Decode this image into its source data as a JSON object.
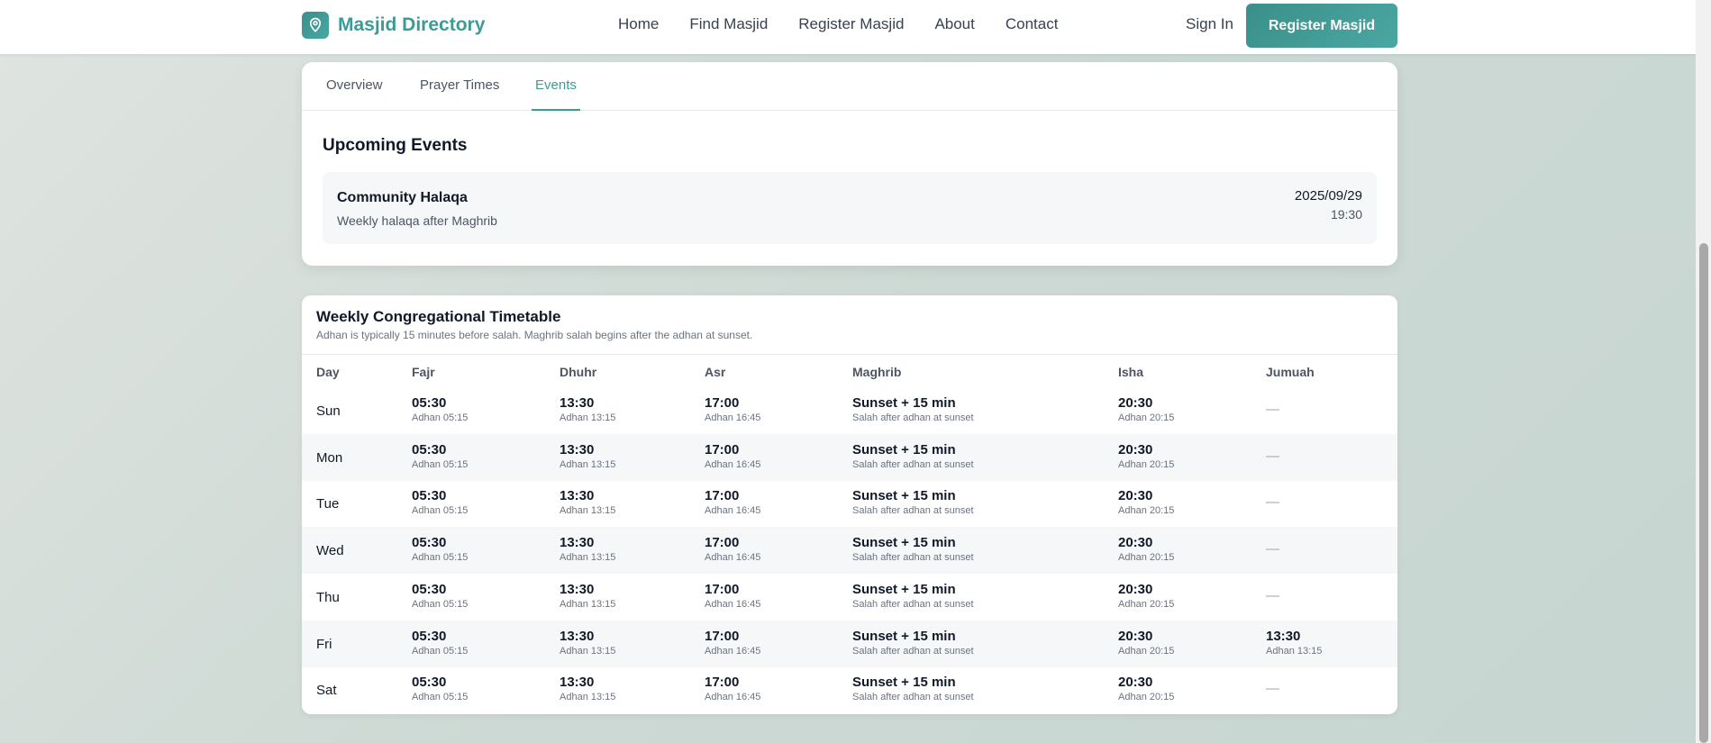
{
  "header": {
    "brand": "Masjid Directory",
    "nav": [
      "Home",
      "Find Masjid",
      "Register Masjid",
      "About",
      "Contact"
    ],
    "sign_in": "Sign In",
    "register_button": "Register Masjid"
  },
  "tabs": [
    {
      "label": "Overview",
      "active": false
    },
    {
      "label": "Prayer Times",
      "active": false
    },
    {
      "label": "Events",
      "active": true
    }
  ],
  "events": {
    "title": "Upcoming Events",
    "items": [
      {
        "name": "Community Halaqa",
        "description": "Weekly halaqa after Maghrib",
        "date": "2025/09/29",
        "time": "19:30"
      }
    ]
  },
  "timetable": {
    "title": "Weekly Congregational Timetable",
    "subtitle": "Adhan is typically 15 minutes before salah. Maghrib salah begins after the adhan at sunset.",
    "columns": [
      "Day",
      "Fajr",
      "Dhuhr",
      "Asr",
      "Maghrib",
      "Isha",
      "Jumuah"
    ],
    "rows": [
      {
        "day": "Sun",
        "fajr": "05:30",
        "fajr_adhan": "Adhan 05:15",
        "dhuhr": "13:30",
        "dhuhr_adhan": "Adhan 13:15",
        "asr": "17:00",
        "asr_adhan": "Adhan 16:45",
        "maghrib": "Sunset + 15 min",
        "maghrib_note": "Salah after adhan at sunset",
        "isha": "20:30",
        "isha_adhan": "Adhan 20:15",
        "jumuah": "—",
        "jumuah_adhan": ""
      },
      {
        "day": "Mon",
        "fajr": "05:30",
        "fajr_adhan": "Adhan 05:15",
        "dhuhr": "13:30",
        "dhuhr_adhan": "Adhan 13:15",
        "asr": "17:00",
        "asr_adhan": "Adhan 16:45",
        "maghrib": "Sunset + 15 min",
        "maghrib_note": "Salah after adhan at sunset",
        "isha": "20:30",
        "isha_adhan": "Adhan 20:15",
        "jumuah": "—",
        "jumuah_adhan": ""
      },
      {
        "day": "Tue",
        "fajr": "05:30",
        "fajr_adhan": "Adhan 05:15",
        "dhuhr": "13:30",
        "dhuhr_adhan": "Adhan 13:15",
        "asr": "17:00",
        "asr_adhan": "Adhan 16:45",
        "maghrib": "Sunset + 15 min",
        "maghrib_note": "Salah after adhan at sunset",
        "isha": "20:30",
        "isha_adhan": "Adhan 20:15",
        "jumuah": "—",
        "jumuah_adhan": ""
      },
      {
        "day": "Wed",
        "fajr": "05:30",
        "fajr_adhan": "Adhan 05:15",
        "dhuhr": "13:30",
        "dhuhr_adhan": "Adhan 13:15",
        "asr": "17:00",
        "asr_adhan": "Adhan 16:45",
        "maghrib": "Sunset + 15 min",
        "maghrib_note": "Salah after adhan at sunset",
        "isha": "20:30",
        "isha_adhan": "Adhan 20:15",
        "jumuah": "—",
        "jumuah_adhan": ""
      },
      {
        "day": "Thu",
        "fajr": "05:30",
        "fajr_adhan": "Adhan 05:15",
        "dhuhr": "13:30",
        "dhuhr_adhan": "Adhan 13:15",
        "asr": "17:00",
        "asr_adhan": "Adhan 16:45",
        "maghrib": "Sunset + 15 min",
        "maghrib_note": "Salah after adhan at sunset",
        "isha": "20:30",
        "isha_adhan": "Adhan 20:15",
        "jumuah": "—",
        "jumuah_adhan": ""
      },
      {
        "day": "Fri",
        "fajr": "05:30",
        "fajr_adhan": "Adhan 05:15",
        "dhuhr": "13:30",
        "dhuhr_adhan": "Adhan 13:15",
        "asr": "17:00",
        "asr_adhan": "Adhan 16:45",
        "maghrib": "Sunset + 15 min",
        "maghrib_note": "Salah after adhan at sunset",
        "isha": "20:30",
        "isha_adhan": "Adhan 20:15",
        "jumuah": "13:30",
        "jumuah_adhan": "Adhan 13:15"
      },
      {
        "day": "Sat",
        "fajr": "05:30",
        "fajr_adhan": "Adhan 05:15",
        "dhuhr": "13:30",
        "dhuhr_adhan": "Adhan 13:15",
        "asr": "17:00",
        "asr_adhan": "Adhan 16:45",
        "maghrib": "Sunset + 15 min",
        "maghrib_note": "Salah after adhan at sunset",
        "isha": "20:30",
        "isha_adhan": "Adhan 20:15",
        "jumuah": "—",
        "jumuah_adhan": ""
      }
    ]
  },
  "colors": {
    "accent": "#3b9c96",
    "text": "#111827",
    "muted": "#6b7280"
  },
  "icons": {
    "brand": "map-pin-icon"
  }
}
